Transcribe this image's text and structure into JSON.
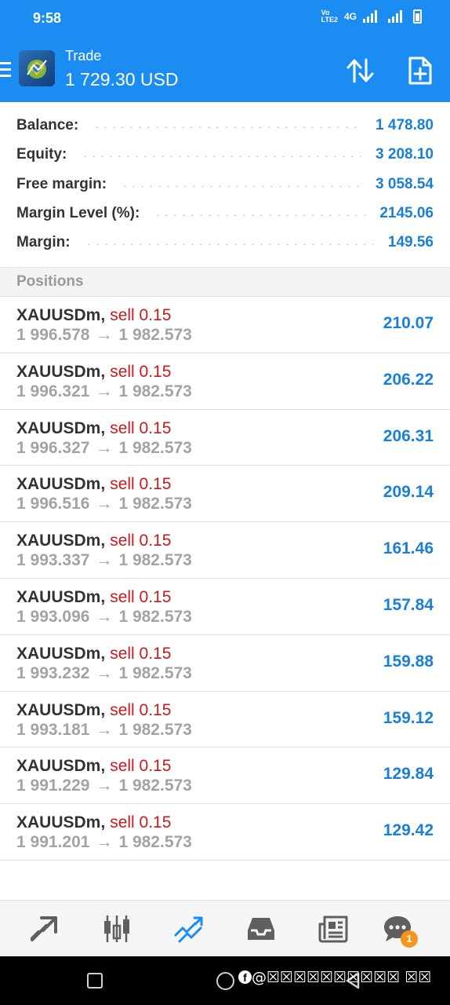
{
  "status_bar": {
    "time": "9:58",
    "network": "4G",
    "volte": "VoLTE2"
  },
  "header": {
    "title": "Trade",
    "balance": "1 729.30 USD"
  },
  "summary": [
    {
      "label": "Balance:",
      "value": "1 478.80"
    },
    {
      "label": "Equity:",
      "value": "3 208.10"
    },
    {
      "label": "Free margin:",
      "value": "3 058.54"
    },
    {
      "label": "Margin Level (%):",
      "value": "2145.06"
    },
    {
      "label": "Margin:",
      "value": "149.56"
    }
  ],
  "positions_title": "Positions",
  "positions": [
    {
      "symbol": "XAUUSDm",
      "type": "sell 0.15",
      "open": "1 996.578",
      "current": "1 982.573",
      "profit": "210.07"
    },
    {
      "symbol": "XAUUSDm",
      "type": "sell 0.15",
      "open": "1 996.321",
      "current": "1 982.573",
      "profit": "206.22"
    },
    {
      "symbol": "XAUUSDm",
      "type": "sell 0.15",
      "open": "1 996.327",
      "current": "1 982.573",
      "profit": "206.31"
    },
    {
      "symbol": "XAUUSDm",
      "type": "sell 0.15",
      "open": "1 996.516",
      "current": "1 982.573",
      "profit": "209.14"
    },
    {
      "symbol": "XAUUSDm",
      "type": "sell 0.15",
      "open": "1 993.337",
      "current": "1 982.573",
      "profit": "161.46"
    },
    {
      "symbol": "XAUUSDm",
      "type": "sell 0.15",
      "open": "1 993.096",
      "current": "1 982.573",
      "profit": "157.84"
    },
    {
      "symbol": "XAUUSDm",
      "type": "sell 0.15",
      "open": "1 993.232",
      "current": "1 982.573",
      "profit": "159.88"
    },
    {
      "symbol": "XAUUSDm",
      "type": "sell 0.15",
      "open": "1 993.181",
      "current": "1 982.573",
      "profit": "159.12"
    },
    {
      "symbol": "XAUUSDm",
      "type": "sell 0.15",
      "open": "1 991.229",
      "current": "1 982.573",
      "profit": "129.84"
    },
    {
      "symbol": "XAUUSDm",
      "type": "sell 0.15",
      "open": "1 991.201",
      "current": "1 982.573",
      "profit": "129.42"
    }
  ],
  "arrow": "→",
  "tabs": [
    {
      "icon": "quotes-icon",
      "active": false
    },
    {
      "icon": "chart-candles-icon",
      "active": false
    },
    {
      "icon": "trade-icon",
      "active": true
    },
    {
      "icon": "history-inbox-icon",
      "active": false
    },
    {
      "icon": "news-icon",
      "active": false
    },
    {
      "icon": "chat-icon",
      "active": false,
      "badge": "1"
    }
  ],
  "watermark": "@☒☒☒☒☒☒☒☒☒☒ ☒☒",
  "colors": {
    "brand": "#1b8cf2",
    "value_blue": "#1a7fd8",
    "sell_red": "#c8191e",
    "badge_orange": "#f6941c",
    "tab_active": "#1b8cf2",
    "tab_inactive": "#5f5f5f"
  }
}
